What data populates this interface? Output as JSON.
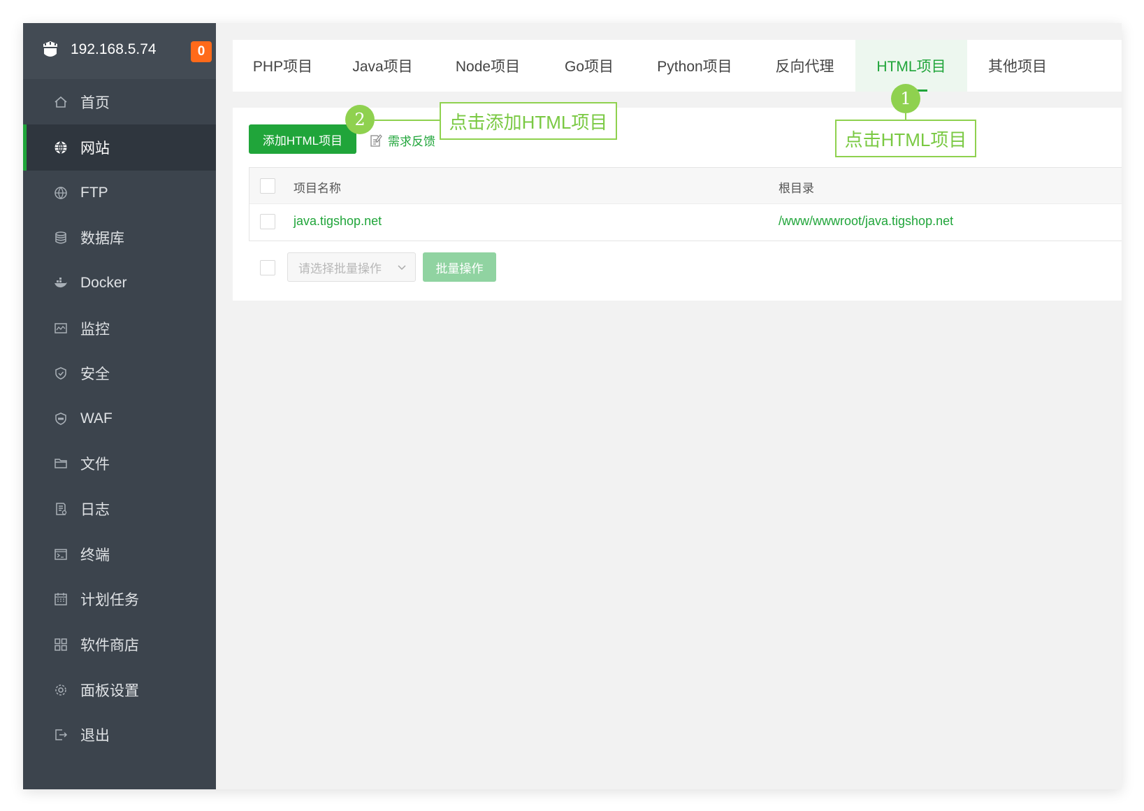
{
  "sidebar": {
    "host": "192.168.5.74",
    "badge": "0",
    "items": [
      {
        "label": "首页",
        "icon": "home-icon"
      },
      {
        "label": "网站",
        "icon": "globe-icon",
        "active": true
      },
      {
        "label": "FTP",
        "icon": "ftp-icon"
      },
      {
        "label": "数据库",
        "icon": "database-icon"
      },
      {
        "label": "Docker",
        "icon": "docker-icon"
      },
      {
        "label": "监控",
        "icon": "monitor-icon"
      },
      {
        "label": "安全",
        "icon": "shield-icon"
      },
      {
        "label": "WAF",
        "icon": "waf-icon"
      },
      {
        "label": "文件",
        "icon": "folder-icon"
      },
      {
        "label": "日志",
        "icon": "log-icon"
      },
      {
        "label": "终端",
        "icon": "terminal-icon"
      },
      {
        "label": "计划任务",
        "icon": "calendar-icon"
      },
      {
        "label": "软件商店",
        "icon": "apps-icon"
      },
      {
        "label": "面板设置",
        "icon": "gear-icon"
      },
      {
        "label": "退出",
        "icon": "logout-icon"
      }
    ]
  },
  "tabs": [
    {
      "label": "PHP项目"
    },
    {
      "label": "Java项目"
    },
    {
      "label": "Node项目"
    },
    {
      "label": "Go项目"
    },
    {
      "label": "Python项目"
    },
    {
      "label": "反向代理"
    },
    {
      "label": "HTML项目",
      "active": true
    },
    {
      "label": "其他项目"
    }
  ],
  "toolbar": {
    "add_label": "添加HTML项目",
    "feedback_label": "需求反馈"
  },
  "table": {
    "columns": [
      "项目名称",
      "根目录"
    ],
    "rows": [
      {
        "name": "java.tigshop.net",
        "root": "/www/wwwroot/java.tigshop.net"
      }
    ]
  },
  "batch": {
    "select_placeholder": "请选择批量操作",
    "button_label": "批量操作"
  },
  "annotations": {
    "step1_number": "1",
    "step1_text": "点击HTML项目",
    "step2_number": "2",
    "step2_text": "点击添加HTML项目"
  },
  "colors": {
    "accent": "#20a53a",
    "sidebar_bg": "#3c444d",
    "badge": "#ff6a1a",
    "annotation": "#8fd14f"
  }
}
